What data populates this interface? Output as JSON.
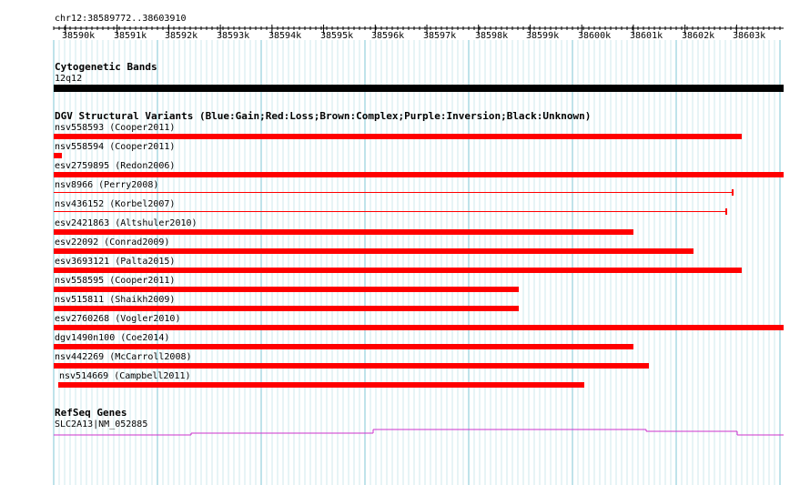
{
  "locus": "chr12:38589772..38603910",
  "ruler": {
    "ticks": [
      "38590k",
      "38591k",
      "38592k",
      "38593k",
      "38594k",
      "38595k",
      "38596k",
      "38597k",
      "38598k",
      "38599k",
      "38600k",
      "38601k",
      "38602k",
      "38603k"
    ]
  },
  "cytobands": {
    "title": "Cytogenetic Bands",
    "band": "12q12",
    "color": "#000000"
  },
  "dgv": {
    "title": "DGV Structural Variants (Blue:Gain;Red:Loss;Brown:Complex;Purple:Inversion;Black:Unknown)",
    "color": "#ff0000",
    "variants": [
      {
        "label": "nsv558593 (Cooper2011)",
        "start": 38589772,
        "end": 38603100,
        "style": "bar"
      },
      {
        "label": "nsv558594 (Cooper2011)",
        "start": 38589772,
        "end": 38589930,
        "style": "bar"
      },
      {
        "label": "esv2759895 (Redon2006)",
        "start": 38589772,
        "end": 38603910,
        "style": "bar"
      },
      {
        "label": "nsv8966 (Perry2008)",
        "start": 38589772,
        "end": 38602900,
        "style": "line"
      },
      {
        "label": "nsv436152 (Korbel2007)",
        "start": 38589772,
        "end": 38602780,
        "style": "line"
      },
      {
        "label": "esv2421863 (Altshuler2010)",
        "start": 38589772,
        "end": 38601000,
        "style": "bar"
      },
      {
        "label": "esv22092 (Conrad2009)",
        "start": 38589772,
        "end": 38602170,
        "style": "bar"
      },
      {
        "label": "esv3693121 (Palta2015)",
        "start": 38589772,
        "end": 38603100,
        "style": "bar"
      },
      {
        "label": "nsv558595 (Cooper2011)",
        "start": 38589772,
        "end": 38598780,
        "style": "bar"
      },
      {
        "label": "nsv515811 (Shaikh2009)",
        "start": 38589772,
        "end": 38598780,
        "style": "bar"
      },
      {
        "label": "esv2760268 (Vogler2010)",
        "start": 38589772,
        "end": 38603910,
        "style": "bar"
      },
      {
        "label": "dgv1490n100 (Coe2014)",
        "start": 38589772,
        "end": 38601000,
        "style": "bar"
      },
      {
        "label": "nsv442269 (McCarroll2008)",
        "start": 38589772,
        "end": 38601300,
        "style": "bar"
      },
      {
        "label": "nsv514669 (Campbell2011)",
        "start": 38589860,
        "end": 38600050,
        "style": "bar"
      }
    ]
  },
  "refseq": {
    "title": "RefSeq Genes",
    "gene": "SLC2A13|NM_052885",
    "color": "#cc33cc"
  }
}
